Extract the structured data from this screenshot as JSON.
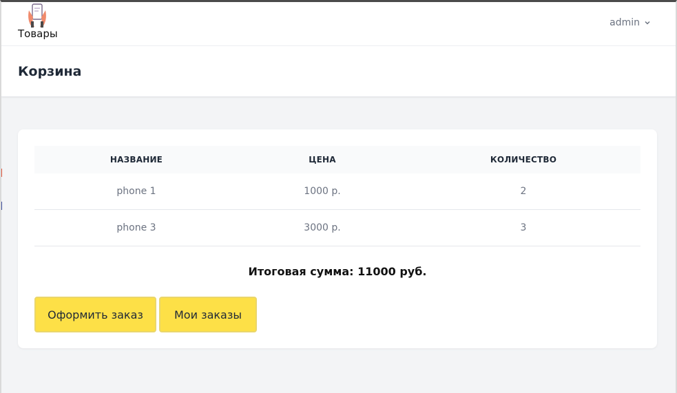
{
  "nav": {
    "brand_label": "Товары",
    "user_name": "admin"
  },
  "header": {
    "title": "Корзина"
  },
  "cart": {
    "columns": [
      "Название",
      "Цена",
      "Количество"
    ],
    "rows": [
      {
        "name": "phone 1",
        "price": "1000 р.",
        "quantity": "2"
      },
      {
        "name": "phone 3",
        "price": "3000 р.",
        "quantity": "3"
      }
    ],
    "total_text": "Итоговая сумма: 11000 руб."
  },
  "actions": {
    "checkout_label": "Оформить заказ",
    "my_orders_label": "Мои заказы"
  },
  "colors": {
    "button_bg": "#fde047",
    "logo_accent": "#f08a6c"
  }
}
